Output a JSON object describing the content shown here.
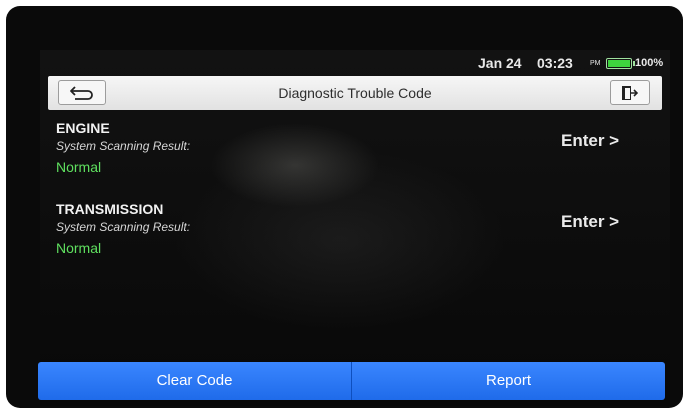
{
  "status_bar": {
    "date": "Jan 24",
    "time": "03:23",
    "ampm": "PM",
    "battery": "100%",
    "battery_level": 1.0,
    "battery_color": "#3ed43e"
  },
  "header": {
    "title": "Diagnostic Trouble Code",
    "back_icon": "back-arrow-icon",
    "exit_icon": "exit-door-icon"
  },
  "systems": [
    {
      "name": "ENGINE",
      "caption": "System Scanning Result:",
      "status": "Normal",
      "enter_label": "Enter >"
    },
    {
      "name": "TRANSMISSION",
      "caption": "System Scanning Result:",
      "status": "Normal",
      "enter_label": "Enter >"
    }
  ],
  "footer": {
    "clear_label": "Clear Code",
    "report_label": "Report",
    "accent": "#2a7bf6"
  },
  "colors": {
    "status_normal": "#5fe05f",
    "background": "#0c0c0c"
  }
}
